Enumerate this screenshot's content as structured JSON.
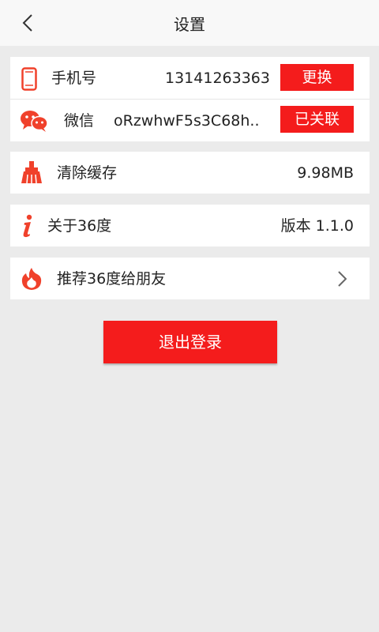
{
  "header": {
    "title": "设置",
    "back_icon": "chevron-left-icon"
  },
  "account": {
    "phone": {
      "label": "手机号",
      "value": "13141263363",
      "button": "更换",
      "icon": "phone-icon"
    },
    "wechat": {
      "label": "微信",
      "value": "oRzwhwF5s3C68h..",
      "button": "已关联",
      "icon": "wechat-icon"
    }
  },
  "cache": {
    "label": "清除缓存",
    "value": "9.98MB",
    "icon": "broom-icon"
  },
  "about": {
    "label": "关于36度",
    "value": "版本 1.1.0",
    "icon": "info-icon"
  },
  "recommend": {
    "label": "推荐36度给朋友",
    "icon": "flame-icon"
  },
  "logout_label": "退出登录",
  "colors": {
    "accent": "#f41c1c",
    "background": "#ebebeb"
  }
}
